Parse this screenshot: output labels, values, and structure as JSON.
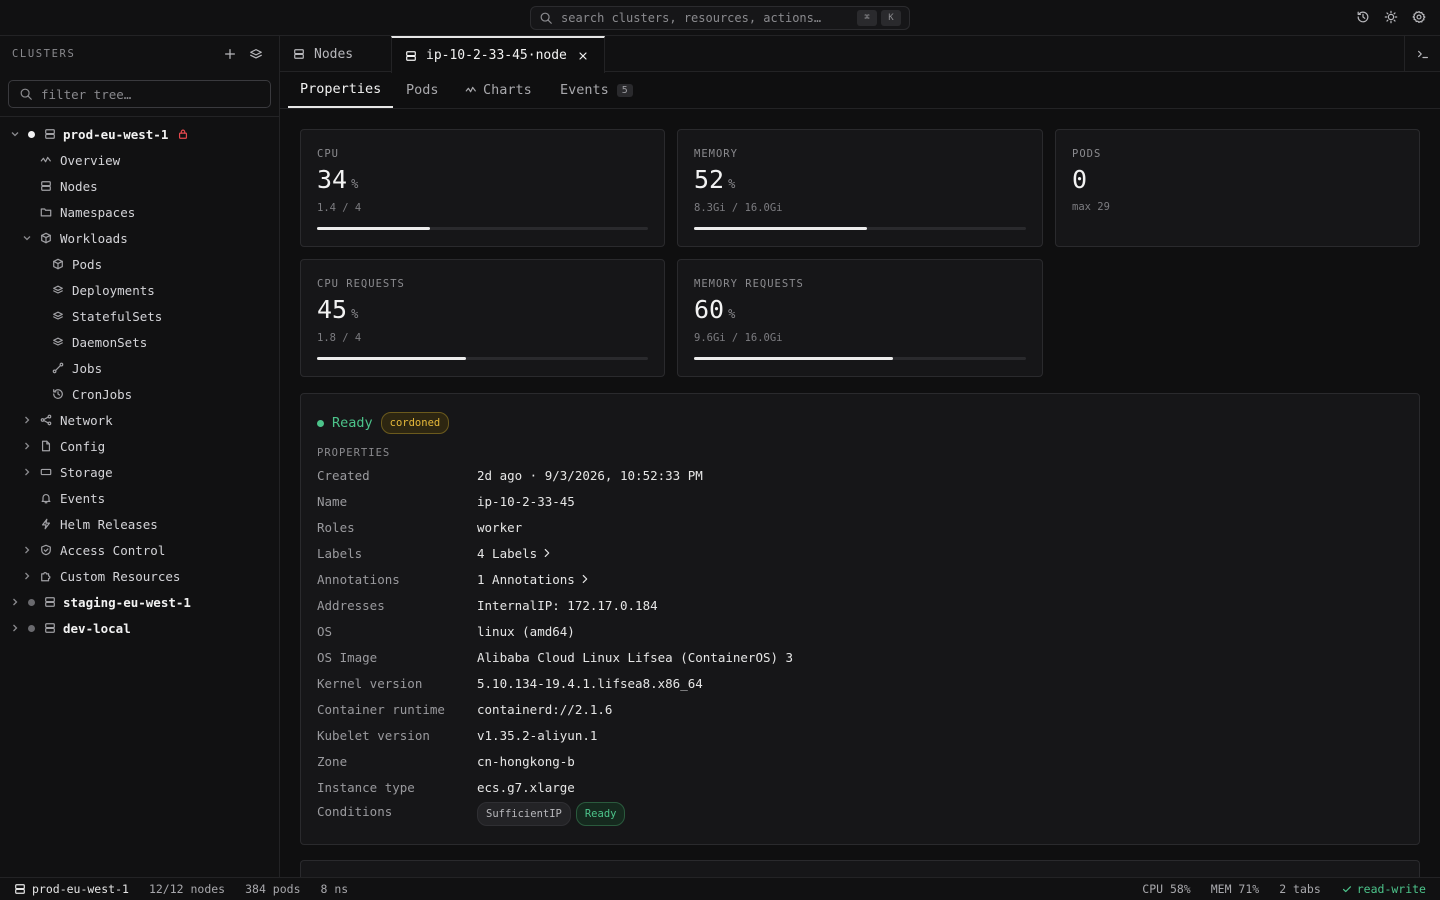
{
  "search": {
    "placeholder": "search clusters, resources, actions…",
    "kbd": [
      "⌘",
      "K"
    ]
  },
  "sidebar": {
    "title": "CLUSTERS",
    "filter_placeholder": "filter tree…",
    "items": [
      {
        "label": "prod-eu-west-1"
      },
      {
        "label": "Overview"
      },
      {
        "label": "Nodes"
      },
      {
        "label": "Namespaces"
      },
      {
        "label": "Workloads"
      },
      {
        "label": "Pods"
      },
      {
        "label": "Deployments"
      },
      {
        "label": "StatefulSets"
      },
      {
        "label": "DaemonSets"
      },
      {
        "label": "Jobs"
      },
      {
        "label": "CronJobs"
      },
      {
        "label": "Network"
      },
      {
        "label": "Config"
      },
      {
        "label": "Storage"
      },
      {
        "label": "Events"
      },
      {
        "label": "Helm Releases"
      },
      {
        "label": "Access Control"
      },
      {
        "label": "Custom Resources"
      },
      {
        "label": "staging-eu-west-1"
      },
      {
        "label": "dev-local"
      }
    ]
  },
  "tabs": [
    {
      "label": "Nodes"
    },
    {
      "label": "ip-10-2-33-45·node"
    }
  ],
  "subtabs": [
    {
      "label": "Properties"
    },
    {
      "label": "Pods"
    },
    {
      "label": "Charts"
    },
    {
      "label": "Events",
      "badge": "5"
    }
  ],
  "metrics": [
    {
      "label": "CPU",
      "value": "34",
      "unit": "%",
      "sub": "1.4 / 4",
      "fill": 0.34
    },
    {
      "label": "MEMORY",
      "value": "52",
      "unit": "%",
      "sub": "8.3Gi / 16.0Gi",
      "fill": 0.52
    },
    {
      "label": "PODS",
      "value": "0",
      "unit": "",
      "sub": "max 29"
    },
    {
      "label": "CPU REQUESTS",
      "value": "45",
      "unit": "%",
      "sub": "1.8 / 4",
      "fill": 0.45
    },
    {
      "label": "MEMORY REQUESTS",
      "value": "60",
      "unit": "%",
      "sub": "9.6Gi / 16.0Gi",
      "fill": 0.6
    }
  ],
  "node": {
    "status": "Ready",
    "badge": "cordoned",
    "section": "PROPERTIES",
    "properties": [
      {
        "key": "Created",
        "value": "2d ago · 9/3/2026, 10:52:33 PM"
      },
      {
        "key": "Name",
        "value": "ip-10-2-33-45"
      },
      {
        "key": "Roles",
        "value": "worker"
      },
      {
        "key": "Labels",
        "value": "4 Labels"
      },
      {
        "key": "Annotations",
        "value": "1 Annotations"
      },
      {
        "key": "Addresses",
        "value": "InternalIP: 172.17.0.184"
      },
      {
        "key": "OS",
        "value": "linux (amd64)"
      },
      {
        "key": "OS Image",
        "value": "Alibaba Cloud Linux Lifsea (ContainerOS) 3"
      },
      {
        "key": "Kernel version",
        "value": "5.10.134-19.4.1.lifsea8.x86_64"
      },
      {
        "key": "Container runtime",
        "value": "containerd://2.1.6"
      },
      {
        "key": "Kubelet version",
        "value": "v1.35.2-aliyun.1"
      },
      {
        "key": "Zone",
        "value": "cn-hongkong-b"
      },
      {
        "key": "Instance type",
        "value": "ecs.g7.xlarge"
      },
      {
        "key": "Conditions",
        "value": ""
      }
    ],
    "conditions": [
      "SufficientIP",
      "Ready"
    ]
  },
  "statusbar": {
    "cluster": "prod-eu-west-1",
    "nodes": "12/12 nodes",
    "pods": "384 pods",
    "ns": "8 ns",
    "cpu": "CPU 58%",
    "mem": "MEM 71%",
    "tabs": "2 tabs",
    "mode": "read-write"
  },
  "colors": {
    "accent_green": "#4cc38a",
    "cordoned": "#e5b83a",
    "lock": "#e5484d"
  }
}
